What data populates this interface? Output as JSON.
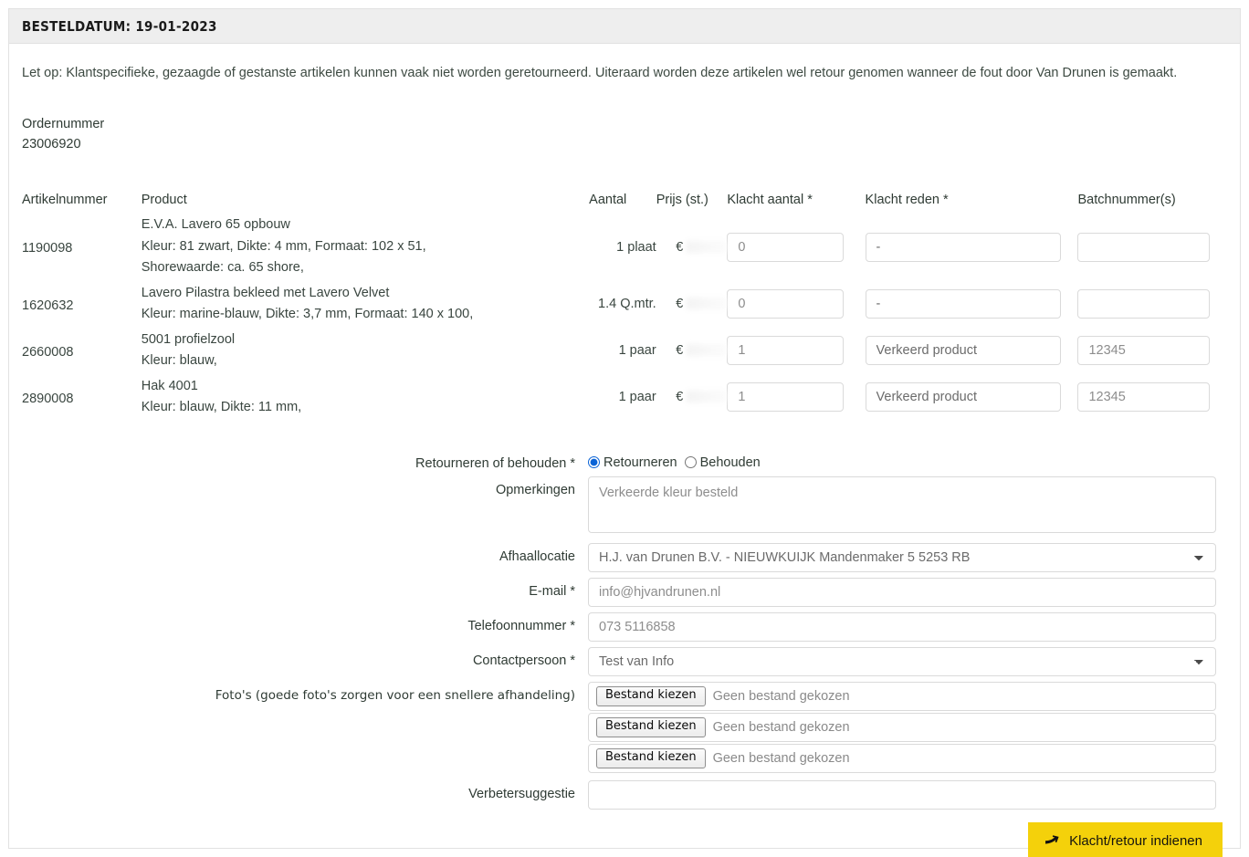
{
  "panel": {
    "header_title": "BESTELDATUM: 19-01-2023",
    "notice": "Let op: Klantspecifieke, gezaagde of gestanste artikelen kunnen vaak niet worden geretourneerd. Uiteraard worden deze artikelen wel retour genomen wanneer de fout door Van Drunen is gemaakt.",
    "order_label": "Ordernummer",
    "order_value": "23006920"
  },
  "table": {
    "headers": {
      "artikelnummer": "Artikelnummer",
      "product": "Product",
      "aantal": "Aantal",
      "prijs": "Prijs (st.)",
      "klacht_aantal": "Klacht aantal *",
      "klacht_reden": "Klacht reden *",
      "batchnummer": "Batchnummer(s)"
    },
    "rows": [
      {
        "artikelnummer": "1190098",
        "product_lines": [
          "E.V.A. Lavero 65 opbouw",
          "Kleur: 81 zwart, Dikte: 4 mm, Formaat: 102 x 51,",
          "Shorewaarde: ca. 65 shore,"
        ],
        "aantal": "1 plaat",
        "prijs_symbol": "€",
        "klacht_aantal": "0",
        "klacht_reden": "-",
        "batchnummer": ""
      },
      {
        "artikelnummer": "1620632",
        "product_lines": [
          "Lavero Pilastra bekleed met Lavero Velvet",
          "Kleur: marine-blauw, Dikte: 3,7 mm, Formaat: 140 x 100,"
        ],
        "aantal": "1.4 Q.mtr.",
        "prijs_symbol": "€",
        "klacht_aantal": "0",
        "klacht_reden": "-",
        "batchnummer": ""
      },
      {
        "artikelnummer": "2660008",
        "product_lines": [
          "5001 profielzool",
          "Kleur: blauw,"
        ],
        "aantal": "1 paar",
        "prijs_symbol": "€",
        "klacht_aantal": "1",
        "klacht_reden": "Verkeerd product",
        "batchnummer": "12345"
      },
      {
        "artikelnummer": "2890008",
        "product_lines": [
          "Hak 4001",
          "Kleur: blauw, Dikte: 11 mm,"
        ],
        "aantal": "1 paar",
        "prijs_symbol": "€",
        "klacht_aantal": "1",
        "klacht_reden": "Verkeerd product",
        "batchnummer": "12345"
      }
    ]
  },
  "form": {
    "return_keep": {
      "label": "Retourneren of behouden *",
      "option_return": "Retourneren",
      "option_keep": "Behouden",
      "selected": "Retourneren"
    },
    "remarks": {
      "label": "Opmerkingen",
      "value": "Verkeerde kleur besteld"
    },
    "pickup": {
      "label": "Afhaallocatie",
      "value": "H.J. van Drunen B.V. - NIEUWKUIJK Mandenmaker 5 5253 RB"
    },
    "email": {
      "label": "E-mail *",
      "value": "info@hjvandrunen.nl"
    },
    "phone": {
      "label": "Telefoonnummer *",
      "value": "073 5116858"
    },
    "contact": {
      "label": "Contactpersoon *",
      "value": "Test van Info"
    },
    "photos": {
      "label": "Foto's (goede foto's zorgen voor een snellere afhandeling)",
      "button_label": "Bestand kiezen",
      "no_file_text": "Geen bestand gekozen",
      "count": 3
    },
    "suggestion": {
      "label": "Verbetersuggestie",
      "value": ""
    },
    "submit": {
      "label": "Klacht/retour indienen",
      "icon": "arrow-right-icon",
      "color": "#f4d10b"
    }
  }
}
